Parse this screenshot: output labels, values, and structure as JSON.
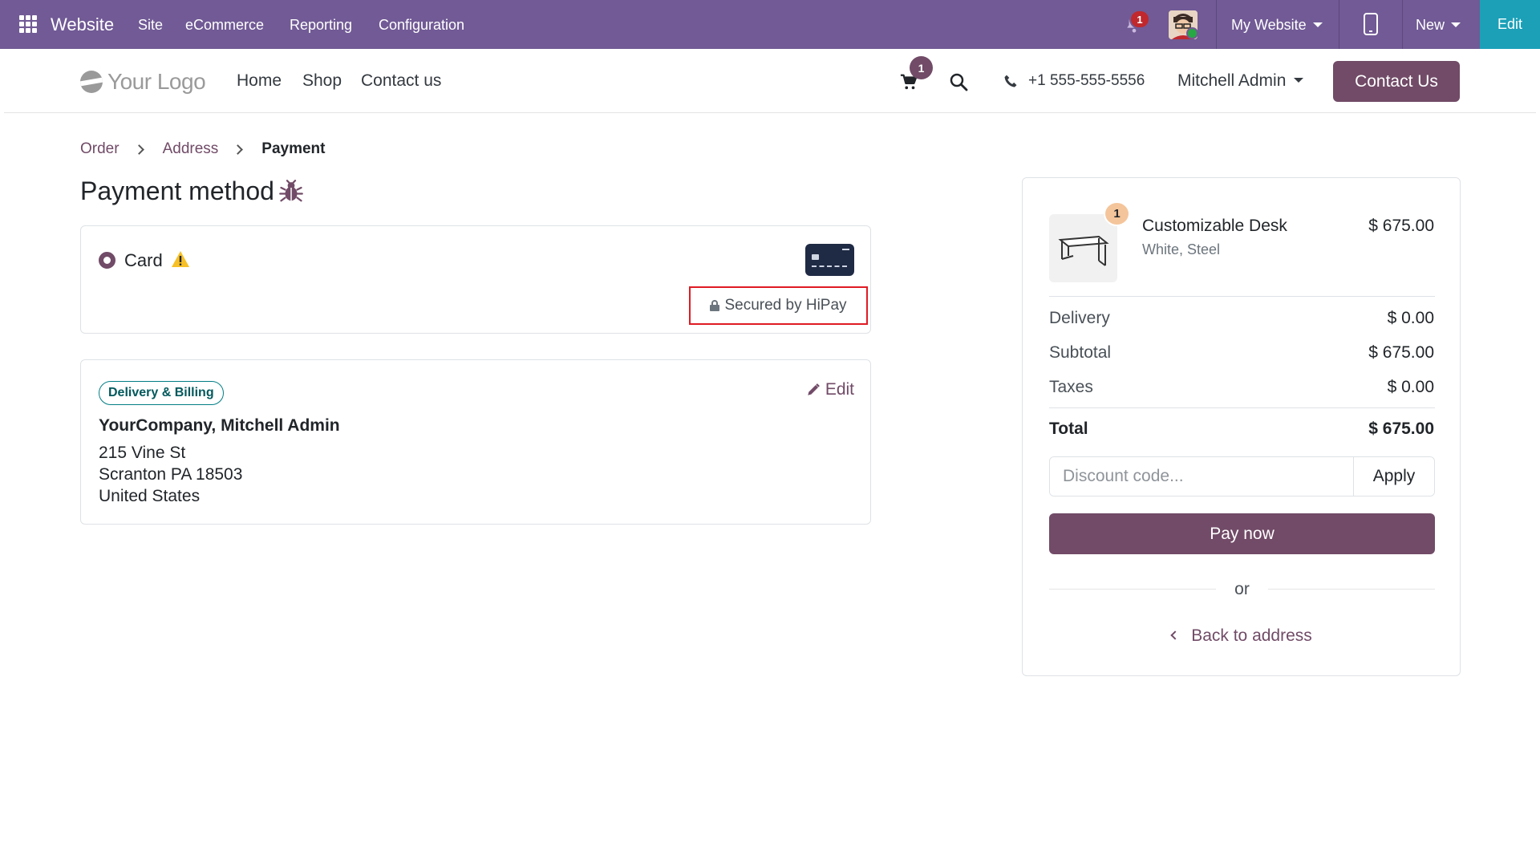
{
  "admin_bar": {
    "brand": "Website",
    "menu": [
      "Site",
      "eCommerce",
      "Reporting",
      "Configuration"
    ],
    "notification_count": "1",
    "website_selector": "My Website",
    "new_label": "New",
    "edit_label": "Edit",
    "background_color": "#715a95",
    "edit_color": "#1ba0b8"
  },
  "header": {
    "logo_text": "Your Logo",
    "nav": [
      "Home",
      "Shop",
      "Contact us"
    ],
    "cart_count": "1",
    "phone": "+1 555-555-5556",
    "user": "Mitchell Admin",
    "contact_button": "Contact Us"
  },
  "breadcrumb": {
    "items": [
      "Order",
      "Address"
    ],
    "active": "Payment"
  },
  "payment": {
    "title": "Payment method",
    "option_label": "Card",
    "secured_text": "Secured by HiPay"
  },
  "address": {
    "badge": "Delivery & Billing",
    "edit_label": "Edit",
    "name": "YourCompany, Mitchell Admin",
    "lines": [
      "215 Vine St",
      "Scranton PA 18503",
      "United States"
    ]
  },
  "summary": {
    "product": {
      "quantity": "1",
      "name": "Customizable Desk",
      "variant": "White, Steel",
      "price": "$ 675.00"
    },
    "rows": [
      {
        "label": "Delivery",
        "value": "$ 0.00"
      },
      {
        "label": "Subtotal",
        "value": "$ 675.00"
      },
      {
        "label": "Taxes",
        "value": "$ 0.00"
      }
    ],
    "total_label": "Total",
    "total_value": "$ 675.00",
    "discount_placeholder": "Discount code...",
    "apply_label": "Apply",
    "pay_label": "Pay now",
    "or_label": "or",
    "back_label": "Back to address",
    "accent_color": "#714b67"
  }
}
